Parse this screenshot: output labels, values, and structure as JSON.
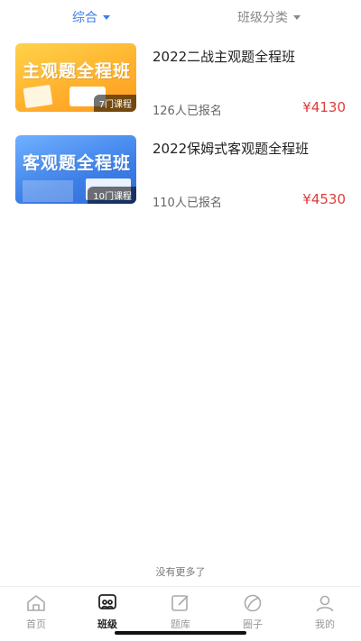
{
  "filters": {
    "all_label": "综合",
    "category_label": "班级分类"
  },
  "courses": [
    {
      "thumb_title": "主观题全程班",
      "thumb_badge": "7门课程",
      "title": "2022二战主观题全程班",
      "enrolled": "126人已报名",
      "price": "¥4130"
    },
    {
      "thumb_title": "客观题全程班",
      "thumb_badge": "10门课程",
      "title": "2022保姆式客观题全程班",
      "enrolled": "110人已报名",
      "price": "¥4530"
    }
  ],
  "list_end_text": "没有更多了",
  "tabbar": {
    "items": [
      {
        "label": "首页",
        "icon": "home-icon",
        "active": false
      },
      {
        "label": "班级",
        "icon": "class-icon",
        "active": true
      },
      {
        "label": "题库",
        "icon": "question-bank-icon",
        "active": false
      },
      {
        "label": "圈子",
        "icon": "circle-icon",
        "active": false
      },
      {
        "label": "我的",
        "icon": "profile-icon",
        "active": false
      }
    ]
  },
  "colors": {
    "accent": "#3f7fe6",
    "price": "#e23a3a",
    "inactive": "#999999"
  }
}
